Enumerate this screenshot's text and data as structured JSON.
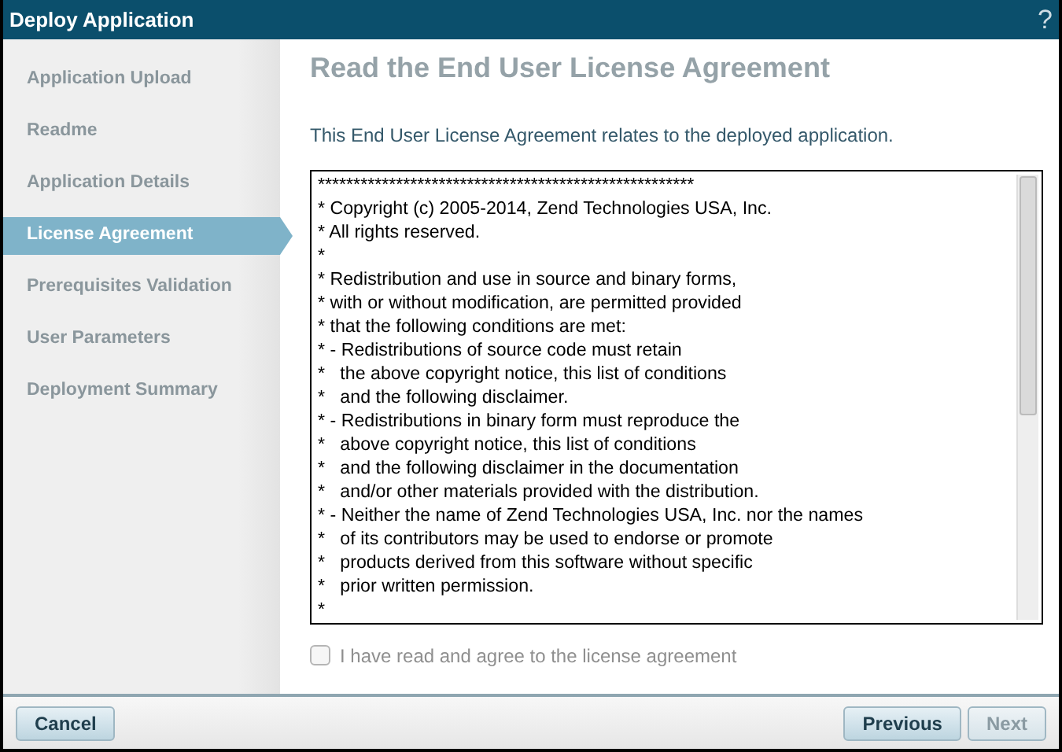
{
  "window": {
    "title": "Deploy Application",
    "help": "?"
  },
  "steps": [
    {
      "label": "Application Upload",
      "selected": false
    },
    {
      "label": "Readme",
      "selected": false
    },
    {
      "label": "Application Details",
      "selected": false
    },
    {
      "label": "License Agreement",
      "selected": true
    },
    {
      "label": "Prerequisites Validation",
      "selected": false
    },
    {
      "label": "User Parameters",
      "selected": false
    },
    {
      "label": "Deployment Summary",
      "selected": false
    }
  ],
  "heading": "Read the End User License Agreement",
  "description": "This End User License Agreement relates to the deployed application.",
  "license_lines": [
    "*****************************************************",
    "* Copyright (c) 2005-2014, Zend Technologies USA, Inc.",
    "* All rights reserved.",
    "*",
    "* Redistribution and use in source and binary forms,",
    "* with or without modification, are permitted provided",
    "* that the following conditions are met:",
    "* - Redistributions of source code must retain",
    "*   the above copyright notice, this list of conditions",
    "*   and the following disclaimer.",
    "* - Redistributions in binary form must reproduce the",
    "*   above copyright notice, this list of conditions",
    "*   and the following disclaimer in the documentation",
    "*   and/or other materials provided with the distribution.",
    "* - Neither the name of Zend Technologies USA, Inc. nor the names",
    "*   of its contributors may be used to endorse or promote",
    "*   products derived from this software without specific",
    "*   prior written permission.",
    "*"
  ],
  "agree": {
    "label": "I have read and agree to the license agreement",
    "checked": false,
    "disabled": true
  },
  "buttons": {
    "cancel": {
      "label": "Cancel",
      "disabled": false
    },
    "previous": {
      "label": "Previous",
      "disabled": false
    },
    "next": {
      "label": "Next",
      "disabled": true
    }
  }
}
